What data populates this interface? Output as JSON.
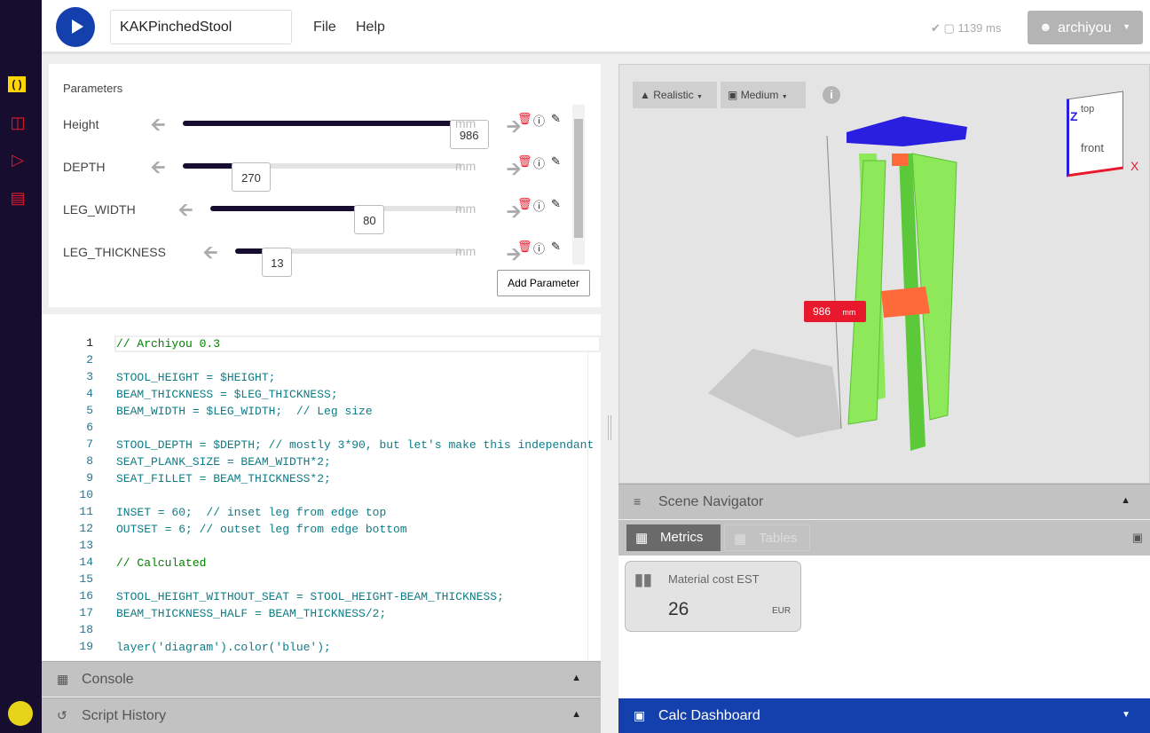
{
  "sidebar": {
    "icons": [
      "parameters-icon",
      "layout-icon",
      "presentation-icon",
      "library-icon",
      "avatar-icon"
    ]
  },
  "header": {
    "title": "KAKPinchedStool",
    "menu": [
      "File",
      "Help"
    ],
    "render_time": "1139 ms",
    "user": "archiyou"
  },
  "parameters": {
    "title": "Parameters",
    "unit": "mm",
    "add_label": "Add Parameter",
    "items": [
      {
        "label": "Height",
        "value": "986",
        "fraction": 0.98
      },
      {
        "label": "DEPTH",
        "value": "270",
        "fraction": 0.2
      },
      {
        "label": "LEG_WIDTH",
        "value": "80",
        "fraction": 0.6
      },
      {
        "label": "LEG_THICKNESS",
        "value": "13",
        "fraction": 0.15
      }
    ]
  },
  "editor": {
    "lines": [
      "// Archiyou 0.3",
      "",
      "STOOL_HEIGHT = $HEIGHT;",
      "BEAM_THICKNESS = $LEG_THICKNESS;",
      "BEAM_WIDTH = $LEG_WIDTH;  // Leg size",
      "",
      "STOOL_DEPTH = $DEPTH; // mostly 3*90, but let's make this independant",
      "SEAT_PLANK_SIZE = BEAM_WIDTH*2;",
      "SEAT_FILLET = BEAM_THICKNESS*2;",
      "",
      "INSET = 60;  // inset leg from edge top",
      "OUTSET = 6; // outset leg from edge bottom",
      "",
      "// Calculated",
      "",
      "STOOL_HEIGHT_WITHOUT_SEAT = STOOL_HEIGHT-BEAM_THICKNESS;",
      "BEAM_THICKNESS_HALF = BEAM_THICKNESS/2;",
      "",
      "layer('diagram').color('blue');"
    ]
  },
  "panels": {
    "console": "Console",
    "history": "Script History",
    "scene": "Scene Navigator",
    "calc": "Calc Dashboard"
  },
  "viewport": {
    "render_mode": "Realistic",
    "quality": "Medium",
    "dimension_value": "986",
    "dimension_unit": "mm",
    "cube": {
      "top": "top",
      "front": "front",
      "z": "Z",
      "x": "X"
    }
  },
  "metrics": {
    "tabs": [
      "Metrics",
      "Tables"
    ],
    "card": {
      "label": "Material cost EST",
      "value": "26",
      "unit": "EUR"
    }
  },
  "colors": {
    "accent": "#1340ac",
    "sidebar": "#170d2e",
    "danger": "#e8192c",
    "seat": "#2a1ee0",
    "legs": "#8de85a"
  }
}
